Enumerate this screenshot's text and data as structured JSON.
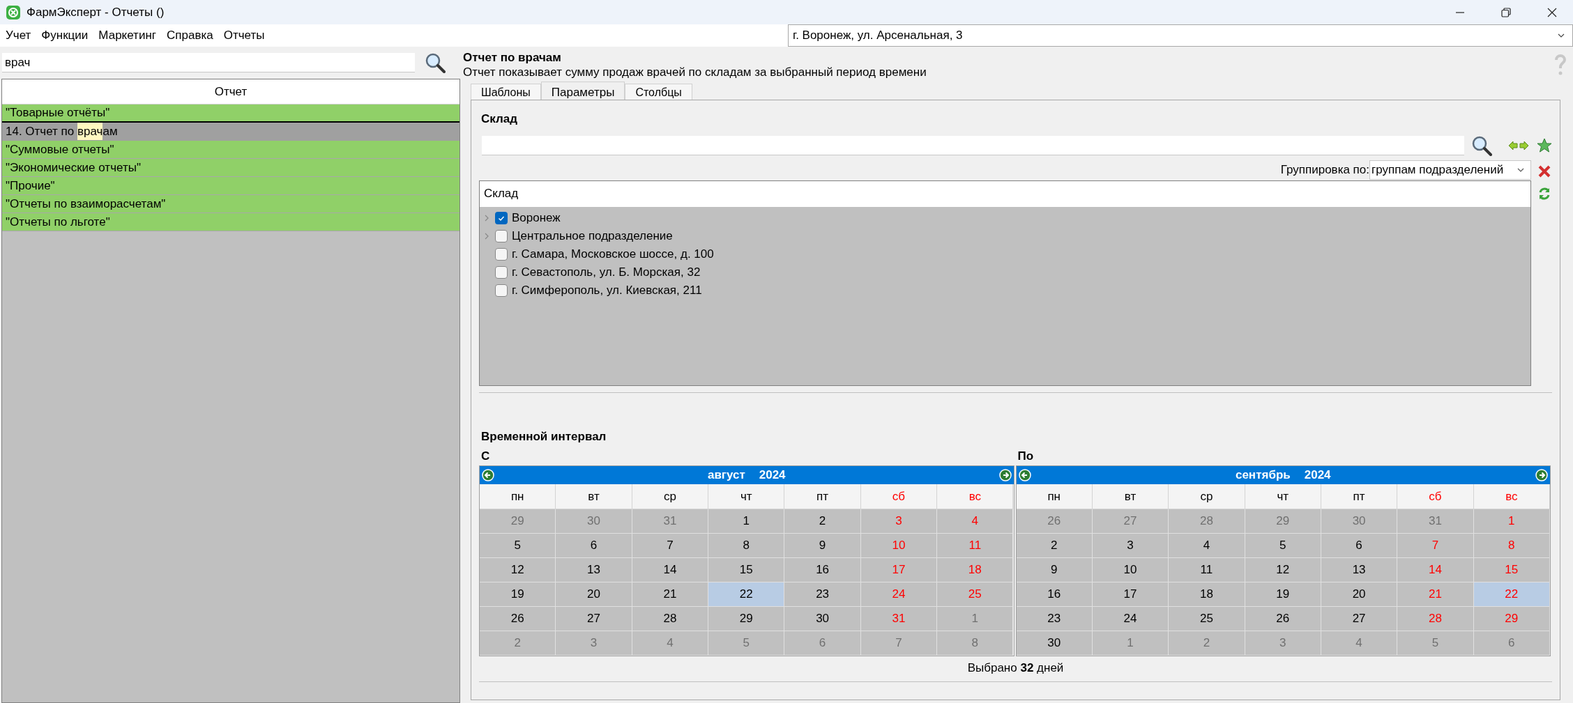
{
  "window": {
    "title": "ФармЭксперт - Отчеты ()"
  },
  "menu": [
    "Учет",
    "Функции",
    "Маркетинг",
    "Справка",
    "Отчеты"
  ],
  "location": {
    "value": "г. Воронеж, ул. Арсенальная, 3"
  },
  "report_search": {
    "value": "врач"
  },
  "report_list": {
    "header": "Отчет",
    "items": [
      {
        "kind": "group",
        "selected": false,
        "text": "\"Товарные отчёты\""
      },
      {
        "kind": "report",
        "selected": true,
        "text": "14. Отчет по ",
        "match": "врач",
        "rest": "ам"
      },
      {
        "kind": "group",
        "selected": false,
        "text": "\"Суммовые отчеты\""
      },
      {
        "kind": "group",
        "selected": false,
        "text": "\"Экономические отчеты\""
      },
      {
        "kind": "group",
        "selected": false,
        "text": "\"Прочие\""
      },
      {
        "kind": "group",
        "selected": false,
        "text": "\"Отчеты по взаиморасчетам\""
      },
      {
        "kind": "group",
        "selected": false,
        "text": "\"Отчеты по льготе\""
      }
    ]
  },
  "report": {
    "title": "Отчет по врачам",
    "description": "Отчет показывает сумму продаж врачей по складам за выбранный период времени"
  },
  "tabs": [
    {
      "label": "Шаблоны",
      "selected": false
    },
    {
      "label": "Параметры",
      "selected": true
    },
    {
      "label": "Столбцы",
      "selected": false
    }
  ],
  "warehouse": {
    "title": "Склад",
    "grouping_label": "Группировка по:",
    "grouping_value": "группам подразделений",
    "tree_header": "Склад",
    "items": [
      {
        "kind": "group",
        "label": "Воронеж",
        "checked": true
      },
      {
        "kind": "group",
        "label": "Центральное подразделение",
        "checked": false
      },
      {
        "kind": "leaf",
        "label": "г. Самара, Московское шоссе, д. 100",
        "checked": false
      },
      {
        "kind": "leaf",
        "label": "г. Севастополь, ул. Б. Морская, 32",
        "checked": false
      },
      {
        "kind": "leaf",
        "label": "г. Симферополь, ул. Киевская, 211",
        "checked": false
      }
    ]
  },
  "interval": {
    "title": "Временной интервал",
    "summary": "Выбрано **32** дней",
    "calendars": [
      {
        "label": "С",
        "month": "август",
        "year": "2024",
        "weekdays": [
          {
            "label": "пн",
            "weekend": false
          },
          {
            "label": "вт",
            "weekend": false
          },
          {
            "label": "ср",
            "weekend": false
          },
          {
            "label": "чт",
            "weekend": false
          },
          {
            "label": "пт",
            "weekend": false
          },
          {
            "label": "сб",
            "weekend": true
          },
          {
            "label": "вс",
            "weekend": true
          }
        ],
        "weeks": [
          [
            {
              "d": "29",
              "outside": true,
              "selected": false
            },
            {
              "d": "30",
              "outside": true,
              "selected": false
            },
            {
              "d": "31",
              "outside": true,
              "selected": false
            },
            {
              "d": "1",
              "outside": false,
              "selected": false
            },
            {
              "d": "2",
              "outside": false,
              "selected": false
            },
            {
              "d": "3",
              "outside": false,
              "selected": false
            },
            {
              "d": "4",
              "outside": false,
              "selected": false
            }
          ],
          [
            {
              "d": "5",
              "outside": false,
              "selected": false
            },
            {
              "d": "6",
              "outside": false,
              "selected": false
            },
            {
              "d": "7",
              "outside": false,
              "selected": false
            },
            {
              "d": "8",
              "outside": false,
              "selected": false
            },
            {
              "d": "9",
              "outside": false,
              "selected": false
            },
            {
              "d": "10",
              "outside": false,
              "selected": false
            },
            {
              "d": "11",
              "outside": false,
              "selected": false
            }
          ],
          [
            {
              "d": "12",
              "outside": false,
              "selected": false
            },
            {
              "d": "13",
              "outside": false,
              "selected": false
            },
            {
              "d": "14",
              "outside": false,
              "selected": false
            },
            {
              "d": "15",
              "outside": false,
              "selected": false
            },
            {
              "d": "16",
              "outside": false,
              "selected": false
            },
            {
              "d": "17",
              "outside": false,
              "selected": false
            },
            {
              "d": "18",
              "outside": false,
              "selected": false
            }
          ],
          [
            {
              "d": "19",
              "outside": false,
              "selected": false
            },
            {
              "d": "20",
              "outside": false,
              "selected": false
            },
            {
              "d": "21",
              "outside": false,
              "selected": false
            },
            {
              "d": "22",
              "outside": false,
              "selected": true
            },
            {
              "d": "23",
              "outside": false,
              "selected": false
            },
            {
              "d": "24",
              "outside": false,
              "selected": false
            },
            {
              "d": "25",
              "outside": false,
              "selected": false
            }
          ],
          [
            {
              "d": "26",
              "outside": false,
              "selected": false
            },
            {
              "d": "27",
              "outside": false,
              "selected": false
            },
            {
              "d": "28",
              "outside": false,
              "selected": false
            },
            {
              "d": "29",
              "outside": false,
              "selected": false
            },
            {
              "d": "30",
              "outside": false,
              "selected": false
            },
            {
              "d": "31",
              "outside": false,
              "selected": false
            },
            {
              "d": "1",
              "outside": true,
              "selected": false
            }
          ],
          [
            {
              "d": "2",
              "outside": true,
              "selected": false
            },
            {
              "d": "3",
              "outside": true,
              "selected": false
            },
            {
              "d": "4",
              "outside": true,
              "selected": false
            },
            {
              "d": "5",
              "outside": true,
              "selected": false
            },
            {
              "d": "6",
              "outside": true,
              "selected": false
            },
            {
              "d": "7",
              "outside": true,
              "selected": false
            },
            {
              "d": "8",
              "outside": true,
              "selected": false
            }
          ]
        ]
      },
      {
        "label": "По",
        "month": "сентябрь",
        "year": "2024",
        "weekdays": [
          {
            "label": "пн",
            "weekend": false
          },
          {
            "label": "вт",
            "weekend": false
          },
          {
            "label": "ср",
            "weekend": false
          },
          {
            "label": "чт",
            "weekend": false
          },
          {
            "label": "пт",
            "weekend": false
          },
          {
            "label": "сб",
            "weekend": true
          },
          {
            "label": "вс",
            "weekend": true
          }
        ],
        "weeks": [
          [
            {
              "d": "26",
              "outside": true,
              "selected": false
            },
            {
              "d": "27",
              "outside": true,
              "selected": false
            },
            {
              "d": "28",
              "outside": true,
              "selected": false
            },
            {
              "d": "29",
              "outside": true,
              "selected": false
            },
            {
              "d": "30",
              "outside": true,
              "selected": false
            },
            {
              "d": "31",
              "outside": true,
              "selected": false
            },
            {
              "d": "1",
              "outside": false,
              "selected": false
            }
          ],
          [
            {
              "d": "2",
              "outside": false,
              "selected": false
            },
            {
              "d": "3",
              "outside": false,
              "selected": false
            },
            {
              "d": "4",
              "outside": false,
              "selected": false
            },
            {
              "d": "5",
              "outside": false,
              "selected": false
            },
            {
              "d": "6",
              "outside": false,
              "selected": false
            },
            {
              "d": "7",
              "outside": false,
              "selected": false
            },
            {
              "d": "8",
              "outside": false,
              "selected": false
            }
          ],
          [
            {
              "d": "9",
              "outside": false,
              "selected": false
            },
            {
              "d": "10",
              "outside": false,
              "selected": false
            },
            {
              "d": "11",
              "outside": false,
              "selected": false
            },
            {
              "d": "12",
              "outside": false,
              "selected": false
            },
            {
              "d": "13",
              "outside": false,
              "selected": false
            },
            {
              "d": "14",
              "outside": false,
              "selected": false
            },
            {
              "d": "15",
              "outside": false,
              "selected": false
            }
          ],
          [
            {
              "d": "16",
              "outside": false,
              "selected": false
            },
            {
              "d": "17",
              "outside": false,
              "selected": false
            },
            {
              "d": "18",
              "outside": false,
              "selected": false
            },
            {
              "d": "19",
              "outside": false,
              "selected": false
            },
            {
              "d": "20",
              "outside": false,
              "selected": false
            },
            {
              "d": "21",
              "outside": false,
              "selected": false
            },
            {
              "d": "22",
              "outside": false,
              "selected": true
            }
          ],
          [
            {
              "d": "23",
              "outside": false,
              "selected": false
            },
            {
              "d": "24",
              "outside": false,
              "selected": false
            },
            {
              "d": "25",
              "outside": false,
              "selected": false
            },
            {
              "d": "26",
              "outside": false,
              "selected": false
            },
            {
              "d": "27",
              "outside": false,
              "selected": false
            },
            {
              "d": "28",
              "outside": false,
              "selected": false
            },
            {
              "d": "29",
              "outside": false,
              "selected": false
            }
          ],
          [
            {
              "d": "30",
              "outside": false,
              "selected": false
            },
            {
              "d": "1",
              "outside": true,
              "selected": false
            },
            {
              "d": "2",
              "outside": true,
              "selected": false
            },
            {
              "d": "3",
              "outside": true,
              "selected": false
            },
            {
              "d": "4",
              "outside": true,
              "selected": false
            },
            {
              "d": "5",
              "outside": true,
              "selected": false
            },
            {
              "d": "6",
              "outside": true,
              "selected": false
            }
          ]
        ]
      }
    ]
  }
}
